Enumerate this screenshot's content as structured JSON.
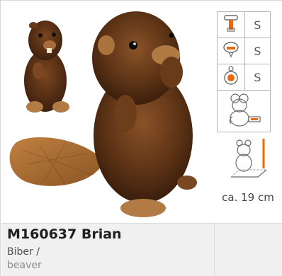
{
  "product": {
    "code_name": "M160637 Brian",
    "subtitle_de": "Biber /",
    "subtitle_en": "beaver"
  },
  "attributes": [
    {
      "icon": "collar-icon",
      "size": "S"
    },
    {
      "icon": "leash-icon",
      "size": "S"
    },
    {
      "icon": "tag-icon",
      "size": "S"
    }
  ],
  "height": {
    "label": "ca. 19 cm"
  },
  "colors": {
    "accent": "#e86a10",
    "icon_stroke": "#6a6a6a",
    "fur_dark": "#4a2a14",
    "fur_mid": "#6e3f1c",
    "tail": "#a56a2c"
  }
}
